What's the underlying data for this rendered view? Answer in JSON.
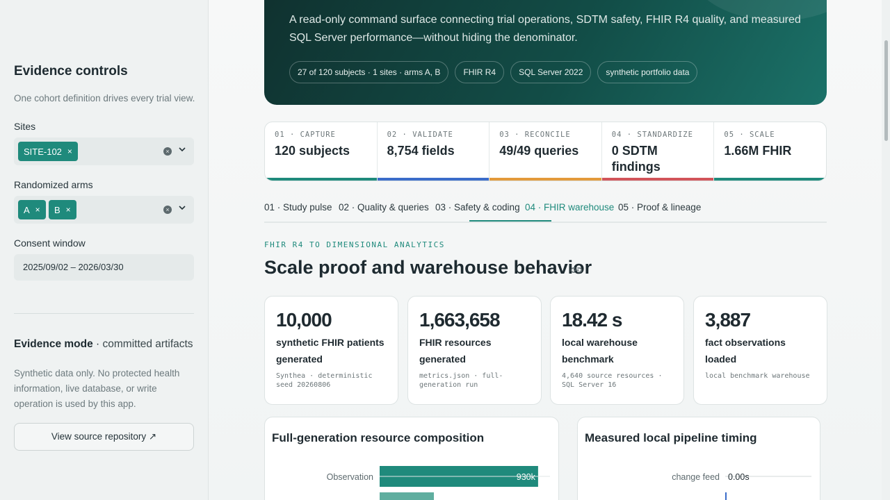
{
  "sidebar": {
    "title": "Evidence controls",
    "subtitle": "One cohort definition drives every trial view.",
    "sites": {
      "label": "Sites",
      "selected": [
        "SITE-102"
      ],
      "remove_glyph": "×"
    },
    "arms": {
      "label": "Randomized arms",
      "selected": [
        "A",
        "B"
      ],
      "remove_glyph": "×"
    },
    "consent": {
      "label": "Consent window",
      "value": "2025/09/02 – 2026/03/30"
    },
    "mode": {
      "title": "Evidence mode",
      "separator": " · ",
      "value": "committed artifacts"
    },
    "mode_desc": "Synthetic data only. No protected health information, live database, or write operation is used by this app.",
    "repo_button": "View source repository ↗"
  },
  "hero": {
    "text": "A read-only command surface connecting trial operations, SDTM safety, FHIR R4 quality, and measured SQL Server performance—without hiding the denominator.",
    "pills": [
      "27 of 120 subjects · 1 sites · arms A, B",
      "FHIR R4",
      "SQL Server 2022",
      "synthetic portfolio data"
    ]
  },
  "steps": [
    {
      "kicker": "01 · CAPTURE",
      "value": "120 subjects",
      "color": "#1f8a7c"
    },
    {
      "kicker": "02 · VALIDATE",
      "value": "8,754 fields",
      "color": "#3b6cc9"
    },
    {
      "kicker": "03 · RECONCILE",
      "value": "49/49 queries",
      "color": "#e39a3b"
    },
    {
      "kicker": "04 · STANDARDIZE",
      "value": "0 SDTM findings",
      "color": "#d2545a"
    },
    {
      "kicker": "05 · SCALE",
      "value": "1.66M FHIR",
      "color": "#1f8a7c"
    }
  ],
  "tabs": [
    "01 · Study pulse",
    "02 · Quality & queries",
    "03 · Safety & coding",
    "04 · FHIR warehouse",
    "05 · Proof & lineage"
  ],
  "active_tab": 3,
  "section": {
    "kicker": "FHIR R4 TO DIMENSIONAL ANALYTICS",
    "title": "Scale proof and warehouse behavior"
  },
  "metrics": [
    {
      "value": "10,000",
      "label": "synthetic FHIR patients generated",
      "note": "Synthea · deterministic seed 20260806"
    },
    {
      "value": "1,663,658",
      "label": "FHIR resources generated",
      "note": "metrics.json · full-generation run"
    },
    {
      "value": "18.42 s",
      "label": "local warehouse benchmark",
      "note": "4,640 source resources · SQL Server 16"
    },
    {
      "value": "3,887",
      "label": "fact observations loaded",
      "note": "local benchmark warehouse"
    }
  ],
  "panels": {
    "composition_title": "Full-generation resource composition",
    "timing_title": "Measured local pipeline timing"
  },
  "chart_data": [
    {
      "type": "bar",
      "title": "Full-generation resource composition",
      "categories": [
        "Observation"
      ],
      "values": [
        930000
      ],
      "data_labels": [
        "930k"
      ],
      "xlim": [
        0,
        1000000
      ]
    },
    {
      "type": "bar",
      "title": "Measured local pipeline timing",
      "categories": [
        "change feed"
      ],
      "values": [
        0.0
      ],
      "data_labels": [
        "0.00s"
      ]
    }
  ],
  "colors": {
    "accent": "#1f8a7c"
  }
}
